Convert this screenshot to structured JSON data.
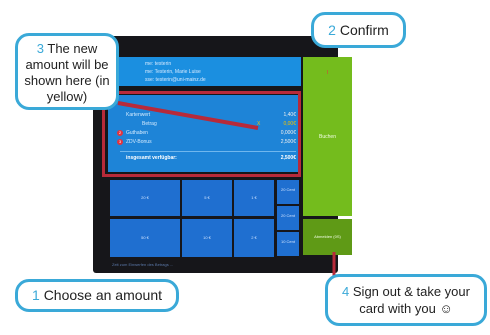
{
  "user": {
    "line1": "me:  testerin",
    "line2": "me:  Testerin, Marie Luise",
    "line3": "sse:  testerin@uni-mainz.de"
  },
  "balance": {
    "card_value_label": "Kartenwert",
    "card_value": "1,40€",
    "amount_label": "Betrag",
    "amount_prefix": "X",
    "amount_value": "0,00€",
    "credit_num": "2",
    "credit_label": "Guthaben",
    "credit_value": "0,000€",
    "bonus_num": "3",
    "bonus_label": "ZDV-Bonus",
    "bonus_value": "2,500€",
    "total_label": "insgesamt verfügbar:",
    "total_value": "2,500€"
  },
  "actions": {
    "marker": "I",
    "book_label": "Buchen",
    "signout_label": "Abmelden (0S)"
  },
  "amounts": {
    "a1": "20 €",
    "a2": "5 €",
    "a3": "1 €",
    "a4": "50 €",
    "a5": "10 €",
    "a6": "2 €",
    "c1": "20 Cent",
    "c2": "20 Cent",
    "c3": "10 Cent"
  },
  "status_line": "Zeit zum Einwerfen des Betrags ...",
  "callouts": {
    "c1_num": "1",
    "c1_text": "Choose an amount",
    "c2_num": "2",
    "c2_text": "Confirm",
    "c3_num": "3",
    "c3_text": "The new amount will be shown here (in yellow)",
    "c4_num": "4",
    "c4_text": "Sign out & take your card with you ☺"
  },
  "colors": {
    "accent_blue": "#1b8fe0",
    "confirm_green": "#74bc1d",
    "highlight_red": "#b72a3a",
    "new_amount_yellow": "#f2c200",
    "callout_border": "#3aa9d8"
  }
}
